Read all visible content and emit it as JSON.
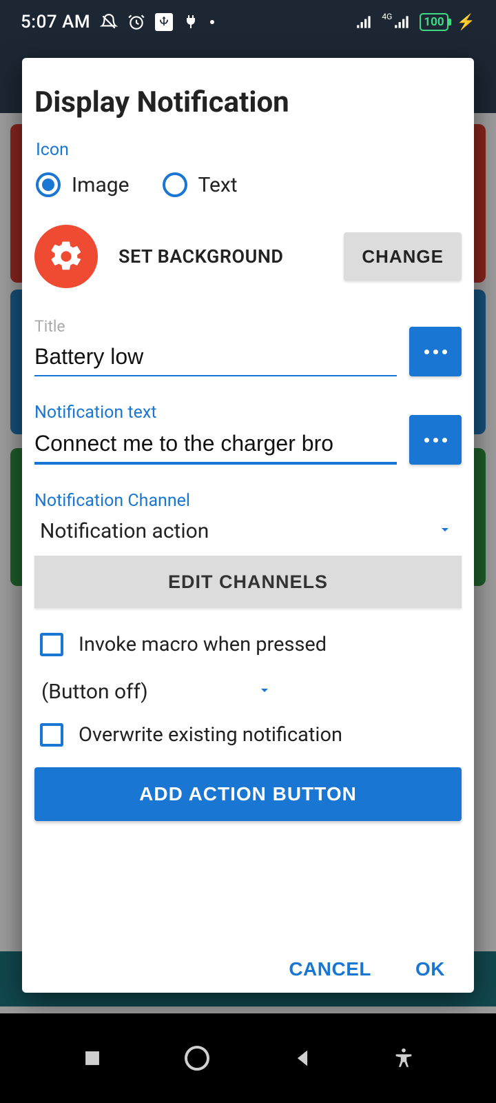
{
  "status": {
    "time": "5:07 AM",
    "battery_level": "100"
  },
  "dialog": {
    "title": "Display Notification",
    "icon": {
      "label": "Icon",
      "radio_image": "Image",
      "radio_text": "Text",
      "selected": "Image",
      "set_background": "SET BACKGROUND",
      "change": "CHANGE"
    },
    "title_field": {
      "label": "Title",
      "value": "Battery low"
    },
    "notification_text": {
      "label": "Notification text",
      "value": "Connect me to the charger bro"
    },
    "channel": {
      "label": "Notification Channel",
      "value": "Notification action",
      "edit": "EDIT CHANNELS"
    },
    "invoke_macro": "Invoke macro when pressed",
    "button_off": "(Button off)",
    "overwrite": "Overwrite existing notification",
    "add_action": "ADD ACTION BUTTON",
    "cancel": "CANCEL",
    "ok": "OK"
  }
}
